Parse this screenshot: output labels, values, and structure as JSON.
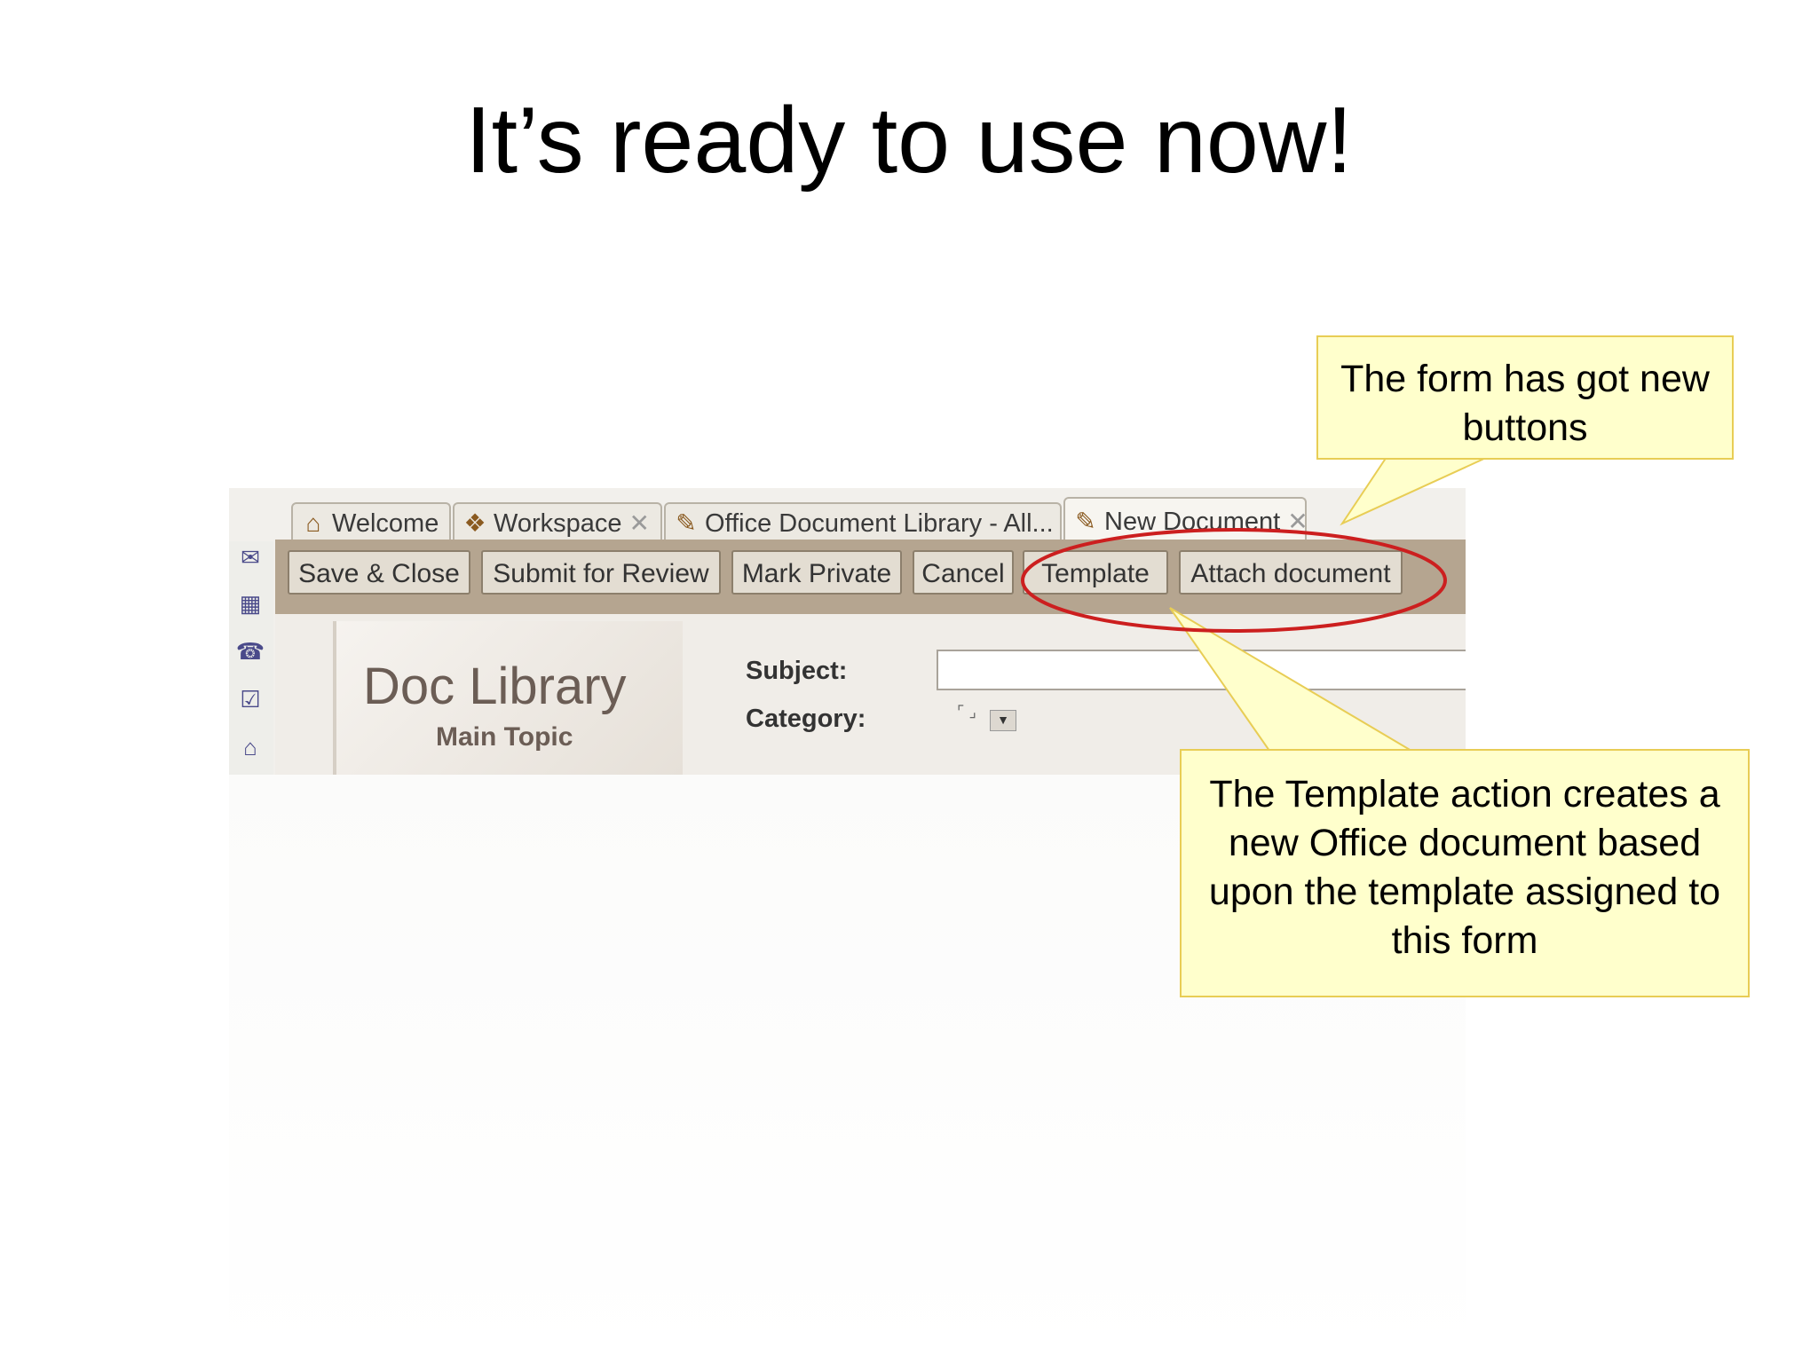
{
  "slide": {
    "title": "It’s ready to use now!"
  },
  "tabs": [
    {
      "label": "Welcome",
      "icon": "home-icon",
      "closable": false
    },
    {
      "label": "Workspace",
      "icon": "workspace-icon",
      "closable": true
    },
    {
      "label": "Office Document Library - All...",
      "icon": "document-library-icon",
      "closable": true
    },
    {
      "label": "New Document",
      "icon": "new-document-icon",
      "closable": true
    }
  ],
  "toolbar": {
    "save_close": "Save & Close",
    "submit_review": "Submit for Review",
    "mark_private": "Mark Private",
    "cancel": "Cancel",
    "template": "Template",
    "attach_document": "Attach document"
  },
  "form": {
    "banner_title": "Doc Library",
    "banner_subtitle": "Main Topic",
    "subject_label": "Subject:",
    "category_label": "Category:",
    "subject_value": ""
  },
  "callouts": {
    "top": "The form has got new buttons",
    "bottom": "The Template action creates a new Office document based upon the template assigned to this form"
  },
  "colors": {
    "callout_fill": "#ffffcc",
    "callout_border": "#e8cd55",
    "highlight_ellipse": "#cc1f1f",
    "toolbar": "#b5a590"
  }
}
